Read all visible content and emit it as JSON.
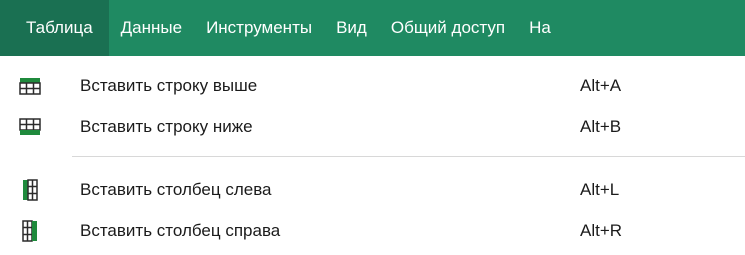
{
  "menubar": {
    "items": [
      {
        "label": "Таблица"
      },
      {
        "label": "Данные"
      },
      {
        "label": "Инструменты"
      },
      {
        "label": "Вид"
      },
      {
        "label": "Общий доступ"
      },
      {
        "label": "На"
      }
    ]
  },
  "dropdown": {
    "items": [
      {
        "label": "Вставить строку выше",
        "shortcut": "Alt+A",
        "icon": "insert-row-above-icon"
      },
      {
        "label": "Вставить строку ниже",
        "shortcut": "Alt+B",
        "icon": "insert-row-below-icon"
      },
      {
        "label": "Вставить столбец слева",
        "shortcut": "Alt+L",
        "icon": "insert-column-left-icon"
      },
      {
        "label": "Вставить столбец справа",
        "shortcut": "Alt+R",
        "icon": "insert-column-right-icon"
      }
    ]
  },
  "colors": {
    "menubar_bg": "#1f8a62",
    "menubar_active_bg": "#1a7052",
    "icon_green": "#1f8a3c",
    "icon_grid": "#2b2b2b"
  }
}
